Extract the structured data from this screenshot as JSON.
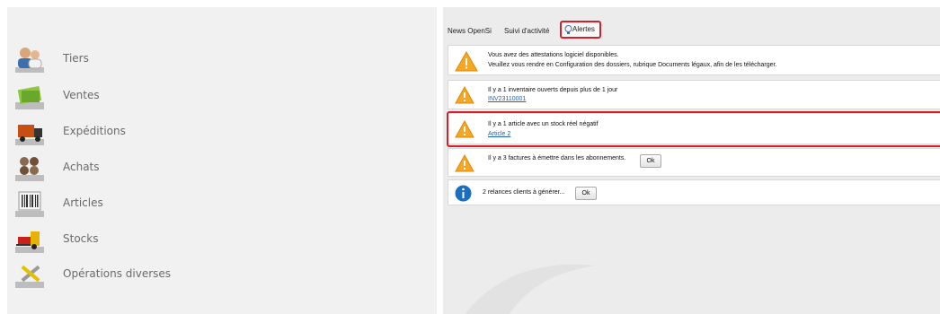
{
  "menu": {
    "items": [
      {
        "label": "Tiers",
        "icon": "users-icon"
      },
      {
        "label": "Ventes",
        "icon": "money-icon"
      },
      {
        "label": "Expéditions",
        "icon": "truck-icon"
      },
      {
        "label": "Achats",
        "icon": "coins-icon"
      },
      {
        "label": "Articles",
        "icon": "barcode-icon"
      },
      {
        "label": "Stocks",
        "icon": "forklift-icon"
      },
      {
        "label": "Opérations diverses",
        "icon": "tools-icon"
      }
    ]
  },
  "tabs": {
    "news": "News OpenSi",
    "activity": "Suivi d'activité",
    "alerts": "Alertes"
  },
  "alerts": {
    "a1": {
      "line1": "Vous avez des attestations logiciel disponibles.",
      "line2": "Veuillez vous rendre en Configuration des dossiers, rubrique Documents légaux, afin de les télécharger."
    },
    "a2": {
      "line1": "Il y a 1 inventaire ouverts depuis plus de 1 jour",
      "link": "INV23110001"
    },
    "a3": {
      "line1": "Il y a 1 article avec un stock réel négatif",
      "link": "Article 2"
    },
    "a4": {
      "line1": "Il y a 3 factures à émettre dans les abonnements.",
      "button": "Ok"
    },
    "a5": {
      "line1": "2 relances clients à générer...",
      "button": "Ok"
    }
  },
  "colors": {
    "highlight": "#d3202b",
    "warning": "#f5a623",
    "info": "#1b6fc2",
    "link": "#1f5fb8"
  }
}
